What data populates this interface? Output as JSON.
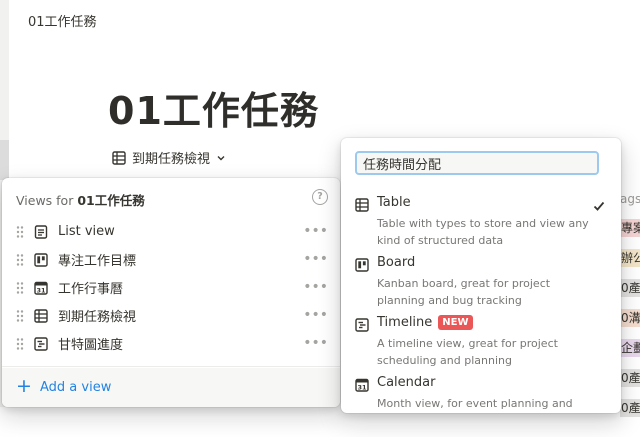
{
  "breadcrumb": "01工作任務",
  "page_title": "01工作任務",
  "current_view": {
    "label": "到期任務檢視",
    "icon": "table-icon"
  },
  "views_panel": {
    "header_prefix": "Views for ",
    "header_name": "01工作任務",
    "help_icon": "?",
    "views": [
      {
        "label": "List view",
        "icon": "list-icon"
      },
      {
        "label": "專注工作目標",
        "icon": "board-icon"
      },
      {
        "label": "工作行事曆",
        "icon": "calendar-icon"
      },
      {
        "label": "到期任務檢視",
        "icon": "table-icon"
      },
      {
        "label": "甘特圖進度",
        "icon": "timeline-icon"
      }
    ],
    "more_glyph": "•••",
    "add_view_label": "Add a view"
  },
  "type_panel": {
    "name_input_value": "任務時間分配",
    "types": [
      {
        "name": "Table",
        "desc": "Table with types to store and view any kind of structured data",
        "selected": true,
        "icon": "table-icon"
      },
      {
        "name": "Board",
        "desc": "Kanban board, great for project planning and bug tracking",
        "selected": false,
        "icon": "board-icon"
      },
      {
        "name": "Timeline",
        "badge": "NEW",
        "desc": "A timeline view, great for project scheduling and planning",
        "selected": false,
        "icon": "timeline-icon"
      },
      {
        "name": "Calendar",
        "desc": "Month view, for event planning and",
        "selected": false,
        "icon": "calendar-icon"
      }
    ]
  },
  "background_table": {
    "header": "ags",
    "tags": [
      {
        "text": "專案",
        "color": "#f5d4d4"
      },
      {
        "text": "辦公",
        "color": "#f4e6c9"
      },
      {
        "text": "0產",
        "color": "#e3e2e0"
      },
      {
        "text": "0溝",
        "color": "#f5ddcf"
      },
      {
        "text": "企劃",
        "color": "#ead9ee"
      },
      {
        "text": "0產",
        "color": "#e3e2e0"
      },
      {
        "text": "0產",
        "color": "#e3e2e0"
      }
    ]
  },
  "colors": {
    "accent": "#2383e2",
    "badge": "#eb5757",
    "text": "#37352f",
    "muted": "#787774"
  }
}
